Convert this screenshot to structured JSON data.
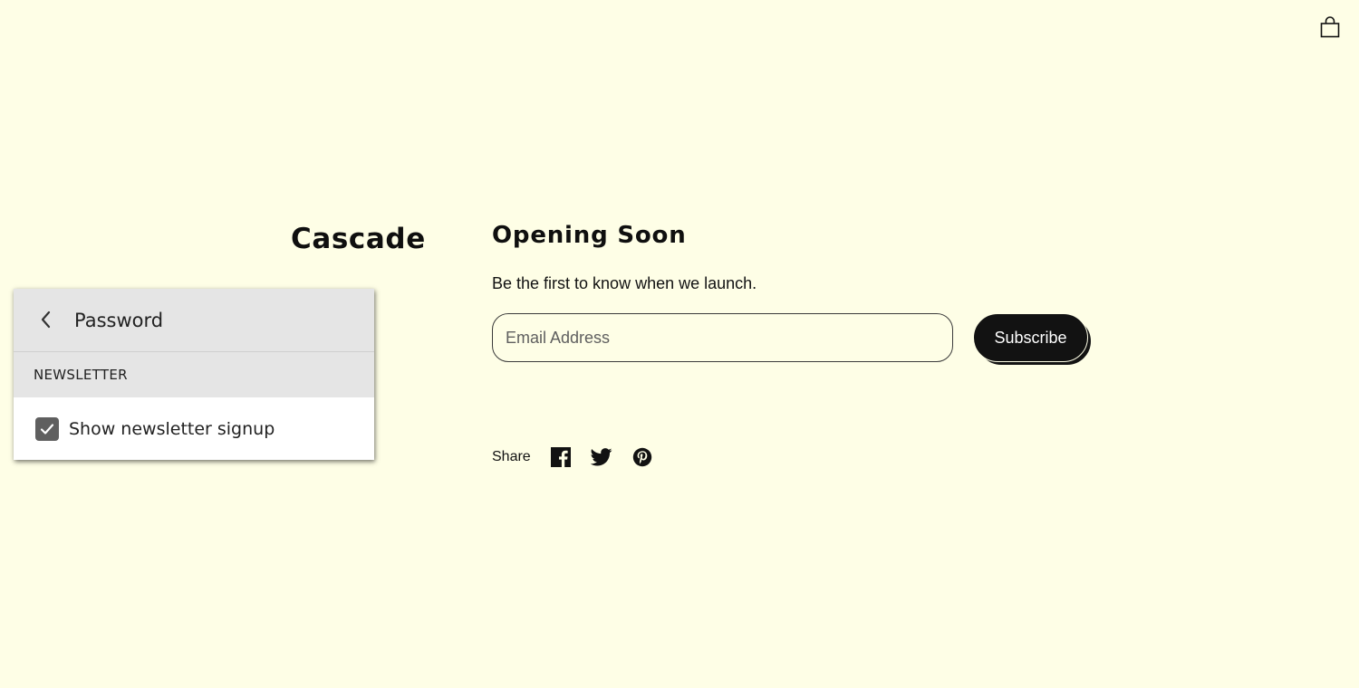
{
  "store": {
    "brand": "Cascade",
    "heading": "Opening Soon",
    "subtext": "Be the first to know when we launch."
  },
  "newsletter_form": {
    "email_placeholder": "Email Address",
    "email_value": "",
    "subscribe_label": "Subscribe"
  },
  "share": {
    "label": "Share",
    "icons": [
      "facebook-icon",
      "twitter-icon",
      "pinterest-icon"
    ]
  },
  "header": {
    "cart_icon": "shopping-bag-icon"
  },
  "settings_panel": {
    "title": "Password",
    "back_icon": "chevron-left-icon",
    "section_heading": "NEWSLETTER",
    "checkbox_label": "Show newsletter signup",
    "checkbox_checked": true
  },
  "colors": {
    "background": "#fefee6",
    "text": "#121212",
    "button": "#121212",
    "panel_header": "#e5e5e5",
    "checkbox": "#5f5f5f"
  }
}
